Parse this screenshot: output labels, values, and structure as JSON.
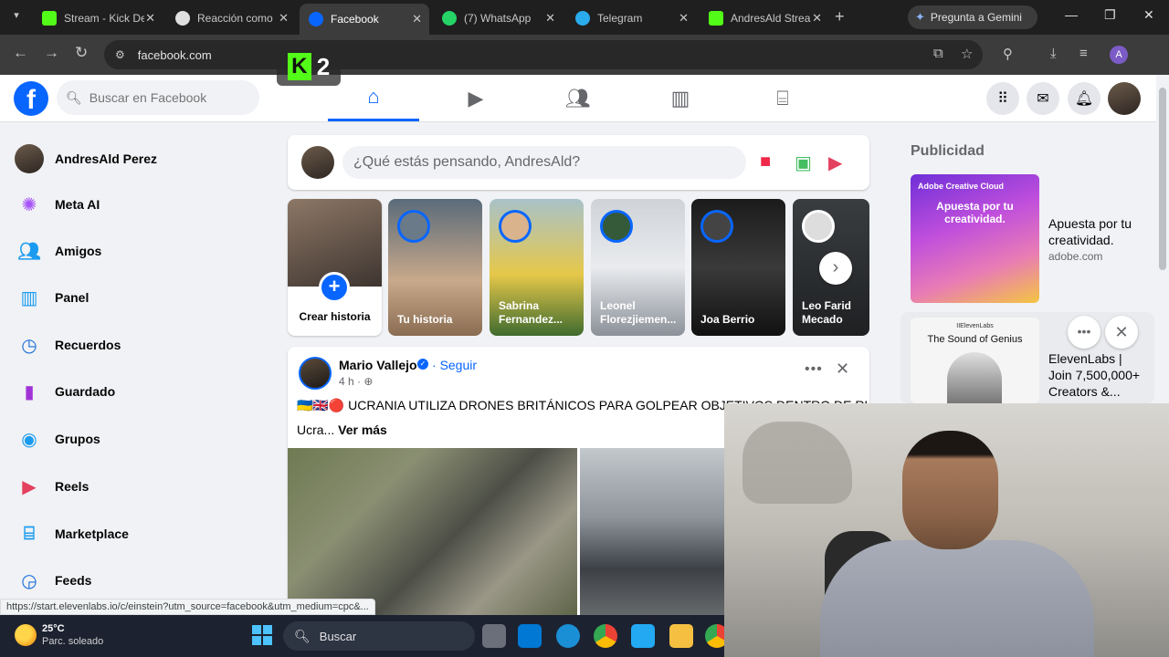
{
  "browser": {
    "tabs": [
      {
        "title": "Stream - Kick De",
        "icon_color": "#53fc18",
        "active": false
      },
      {
        "title": "Reacción como",
        "icon_color": "#e0e0e0",
        "active": false
      },
      {
        "title": "Facebook",
        "icon_color": "#0866ff",
        "active": true
      },
      {
        "title": "(7) WhatsApp",
        "icon_color": "#25d366",
        "active": false
      },
      {
        "title": "Telegram",
        "icon_color": "#2aabee",
        "active": false
      },
      {
        "title": "AndresAld Strea",
        "icon_color": "#53fc18",
        "active": false
      }
    ],
    "gemini_label": "Pregunta a Gemini",
    "url": "facebook.com",
    "profile_initial": "A",
    "status_url": "https://start.elevenlabs.io/c/einstein?utm_source=facebook&utm_medium=cpc&..."
  },
  "overlay": {
    "kick_number": "2"
  },
  "fb": {
    "search_placeholder": "Buscar en Facebook",
    "nav_tabs": [
      "home",
      "video",
      "friends",
      "dashboard",
      "marketplace"
    ],
    "sidebar": [
      {
        "label": "AndresAld Perez",
        "icon": "avatar"
      },
      {
        "label": "Meta AI",
        "icon": "meta-ai-icon"
      },
      {
        "label": "Amigos",
        "icon": "friends-icon"
      },
      {
        "label": "Panel",
        "icon": "panel-icon"
      },
      {
        "label": "Recuerdos",
        "icon": "memories-icon"
      },
      {
        "label": "Guardado",
        "icon": "saved-icon"
      },
      {
        "label": "Grupos",
        "icon": "groups-icon"
      },
      {
        "label": "Reels",
        "icon": "reels-icon"
      },
      {
        "label": "Marketplace",
        "icon": "marketplace-icon"
      },
      {
        "label": "Feeds",
        "icon": "feeds-icon"
      }
    ],
    "composer_placeholder": "¿Qué estás pensando, AndresAld?",
    "stories": {
      "create_label": "Crear historia",
      "items": [
        {
          "name": "Tu historia"
        },
        {
          "name": "Sabrina Fernandez..."
        },
        {
          "name": "Leonel Florezjiemen..."
        },
        {
          "name": "Joa Berrio"
        },
        {
          "name": "Leo Farid Mecado"
        }
      ]
    },
    "post": {
      "author": "Mario Vallejo",
      "follow_label": "Seguir",
      "time": "4 h",
      "text": "🇺🇦🇬🇧🔴 UCRANIA UTILIZA DRONES BRITÁNICOS PARA GOLPEAR OBJETIVOS DENTRO DE RUSIA",
      "text_prefix": "Ucra...",
      "see_more": "Ver más"
    },
    "ads": {
      "title": "Publicidad",
      "ad1": {
        "brand": "Adobe Creative Cloud",
        "headline": "Apuesta por tu creatividad.",
        "title": "Apuesta por tu creatividad.",
        "url": "adobe.com"
      },
      "ad2": {
        "brand": "IIElevenLabs",
        "headline": "The Sound of Genius",
        "title": "ElevenLabs | Join 7,500,000+ Creators &..."
      }
    }
  },
  "taskbar": {
    "temp": "25°C",
    "weather_desc": "Parc. soleado",
    "search_label": "Buscar"
  },
  "colors": {
    "fb_blue": "#0866ff",
    "kick_green": "#53fc18"
  }
}
